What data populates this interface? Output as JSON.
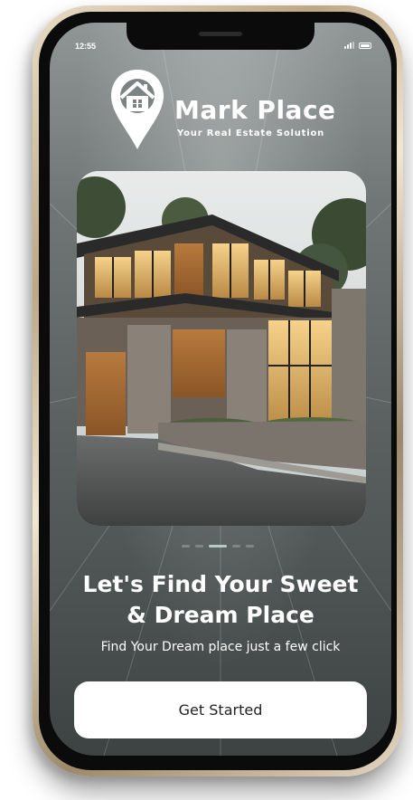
{
  "status_bar": {
    "time": "12:55",
    "signal_icon": "signal-icon",
    "battery_icon": "battery-icon"
  },
  "brand": {
    "logo_icon": "location-pin-house-icon",
    "name": "Mark Place",
    "tagline": "Your Real Estate Solution"
  },
  "hero": {
    "image_description_icon": "modern-house-photo"
  },
  "carousel": {
    "total_slides": 5,
    "active_index": 2
  },
  "onboarding": {
    "headline_line1": "Let's Find Your Sweet",
    "headline_line2": "& Dream Place",
    "subheadline": "Find Your Dream place just a few click",
    "cta_label": "Get Started"
  },
  "colors": {
    "cta_background": "#ffffff",
    "text_primary": "#ffffff",
    "dot_active": "#b8c9c7",
    "dot_inactive": "#808686"
  }
}
